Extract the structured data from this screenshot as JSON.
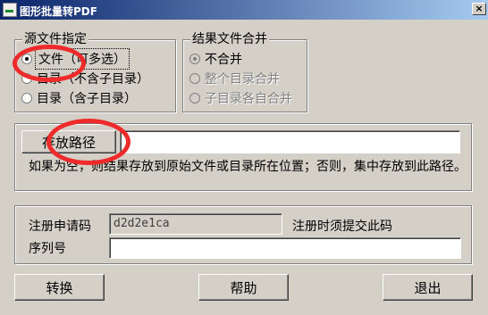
{
  "window": {
    "title": "图形批量转PDF",
    "close_glyph": "×"
  },
  "source": {
    "title": "源文件指定",
    "options": [
      {
        "label": "文件（可多选）",
        "checked": true
      },
      {
        "label": "目录（不含子目录）",
        "checked": false
      },
      {
        "label": "目录（含子目录）",
        "checked": false
      }
    ]
  },
  "merge": {
    "title": "结果文件合并",
    "options": [
      {
        "label": "不合并",
        "checked": true
      },
      {
        "label": "整个目录合并",
        "checked": false
      },
      {
        "label": "子目录各自合并",
        "checked": false
      }
    ]
  },
  "output": {
    "button_label": "存放路径",
    "path_value": "",
    "hint": "如果为空，则结果存放到原始文件或目录所在位置；否则，集中存放到此路径。"
  },
  "registration": {
    "request_label": "注册申请码",
    "request_code": "d2d2e1ca",
    "request_note": "注册时须提交此码",
    "serial_label": "序列号",
    "serial_value": ""
  },
  "actions": {
    "convert": "转换",
    "help": "帮助",
    "exit": "退出"
  },
  "annotations": {
    "color": "#ee2a2a"
  }
}
